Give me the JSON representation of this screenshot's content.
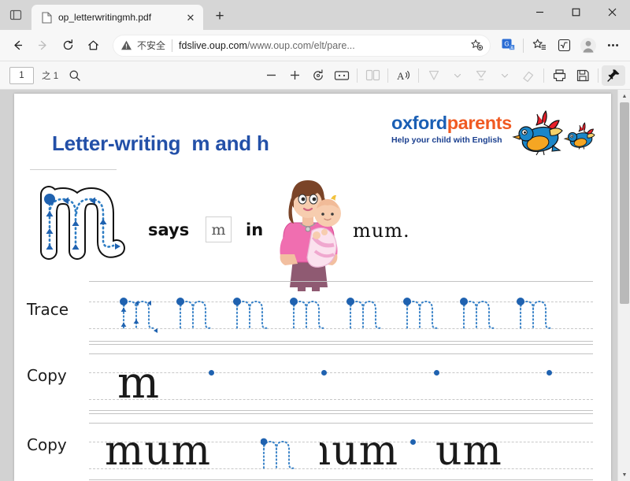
{
  "window": {
    "minimize_label": "—",
    "maximize_label": "☐",
    "close_label": "✕"
  },
  "tabs": {
    "tab_list_icon": "tab-list-icon",
    "items": [
      {
        "title": "op_letterwritingmh.pdf",
        "favicon": "pdf-file-icon",
        "close_label": "✕"
      }
    ],
    "new_tab_label": "+"
  },
  "nav": {
    "back_label": "←",
    "forward_label": "→",
    "refresh_label": "↻",
    "home_label": "⌂",
    "security_warning": "不安全",
    "url_host": "fdslive.oup.com",
    "url_path": "/www.oup.com/elt/pare...",
    "url_full": "fdslive.oup.com/www.oup.com/elt/pare...",
    "favorite_label": "add-favorite",
    "translate_label": "translate",
    "collections_label": "collections",
    "math_solver_label": "math-solver",
    "profile_label": "profile",
    "settings_label": "⋯"
  },
  "pdf_toolbar": {
    "page_number": "1",
    "page_total": "之 1",
    "search_label": "search",
    "zoom_out_label": "−",
    "zoom_in_label": "+",
    "rotate_label": "rotate",
    "fit_page_label": "fit-to-page",
    "page_view_label": "page-view",
    "read_aloud_label": "A",
    "draw_label": "draw",
    "draw_caret_label": "⌄",
    "highlight_label": "highlight",
    "highlight_caret_label": "⌄",
    "erase_label": "erase",
    "print_label": "print",
    "save_label": "save",
    "pin_label": "pin-toolbar"
  },
  "scrollbar": {
    "up_label": "▲",
    "down_label": "▼"
  },
  "document": {
    "logo": {
      "word_part1": "oxford",
      "word_part2": "parents",
      "tagline": "Help your child with English",
      "bird_icon": "bird-mascot-icon",
      "color_part1": "#1a5fb4",
      "color_part2": "#f05a22"
    },
    "title_prefix": "Letter-writing",
    "title_letter1": "m",
    "title_and": "and",
    "title_letter2": "h",
    "title_color": "#2350a8",
    "says_word": "says",
    "boxed_letter": "m",
    "in_word": "in",
    "example_word": "mum.",
    "big_letter": "m",
    "illustration": "mother-holding-baby-illustration",
    "rows": [
      {
        "label": "Trace",
        "style": "trace",
        "glyphs": [
          "m",
          "m",
          "m",
          "m",
          "m",
          "m",
          "m",
          "m"
        ]
      },
      {
        "label": "Copy",
        "style": "copy-letter",
        "glyphs": [
          "m"
        ],
        "dot_count": 4
      },
      {
        "label": "Copy",
        "style": "copy-word",
        "words": [
          "mum",
          "mum",
          "um"
        ]
      }
    ]
  }
}
